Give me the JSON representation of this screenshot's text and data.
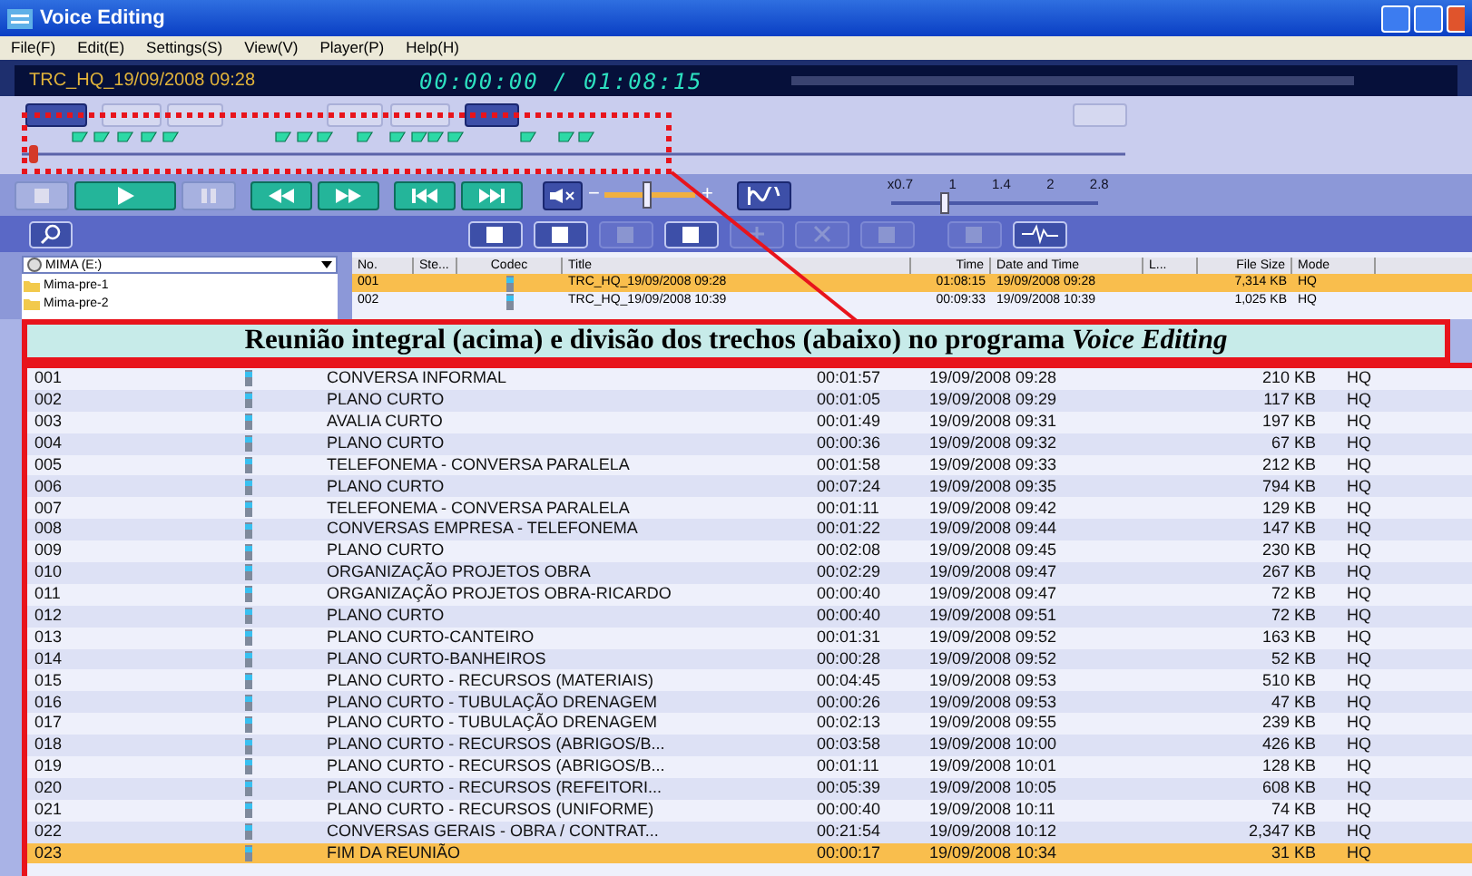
{
  "window": {
    "title": "Voice Editing"
  },
  "menu": [
    "File(F)",
    "Edit(E)",
    "Settings(S)",
    "View(V)",
    "Player(P)",
    "Help(H)"
  ],
  "display": {
    "track": "TRC_HQ_19/09/2008 09:28",
    "time": "00:00:00 / 01:08:15"
  },
  "volume": {
    "minus": "−",
    "plus": "+",
    "level": 0.45
  },
  "speed": {
    "labels": [
      "x0.7",
      "1",
      "1.4",
      "2",
      "2.8"
    ],
    "level": 0.25
  },
  "folders": {
    "drive": "MIMA (E:)",
    "items": [
      "Mima-pre-1",
      "Mima-pre-2"
    ]
  },
  "file_list": {
    "columns": [
      "No.",
      "Ste...",
      "Codec",
      "Title",
      "Time",
      "Date and Time",
      "L...",
      "File Size",
      "Mode"
    ],
    "rows": [
      {
        "no": "001",
        "title": "TRC_HQ_19/09/2008 09:28",
        "time": "01:08:15",
        "date": "19/09/2008 09:28",
        "size": "7,314 KB",
        "mode": "HQ",
        "selected": true
      },
      {
        "no": "002",
        "title": "TRC_HQ_19/09/2008 10:39",
        "time": "00:09:33",
        "date": "19/09/2008 10:39",
        "size": "1,025 KB",
        "mode": "HQ",
        "selected": false
      }
    ]
  },
  "caption": "Reunião integral (acima) e divisão dos trechos (abaixo) no programa *Voice Editing*",
  "segments": [
    {
      "no": "001",
      "title": "CONVERSA INFORMAL",
      "time": "00:01:57",
      "date": "19/09/2008 09:28",
      "size": "210 KB",
      "mode": "HQ",
      "selected": false
    },
    {
      "no": "002",
      "title": "PLANO CURTO",
      "time": "00:01:05",
      "date": "19/09/2008 09:29",
      "size": "117 KB",
      "mode": "HQ",
      "selected": false
    },
    {
      "no": "003",
      "title": "AVALIA CURTO",
      "time": "00:01:49",
      "date": "19/09/2008 09:31",
      "size": "197 KB",
      "mode": "HQ",
      "selected": false
    },
    {
      "no": "004",
      "title": "PLANO CURTO",
      "time": "00:00:36",
      "date": "19/09/2008 09:32",
      "size": "67 KB",
      "mode": "HQ",
      "selected": false
    },
    {
      "no": "005",
      "title": "TELEFONEMA - CONVERSA PARALELA",
      "time": "00:01:58",
      "date": "19/09/2008 09:33",
      "size": "212 KB",
      "mode": "HQ",
      "selected": false
    },
    {
      "no": "006",
      "title": "PLANO CURTO",
      "time": "00:07:24",
      "date": "19/09/2008 09:35",
      "size": "794 KB",
      "mode": "HQ",
      "selected": false
    },
    {
      "no": "007",
      "title": "TELEFONEMA - CONVERSA PARALELA",
      "time": "00:01:11",
      "date": "19/09/2008 09:42",
      "size": "129 KB",
      "mode": "HQ",
      "selected": false
    },
    {
      "no": "008",
      "title": "CONVERSAS EMPRESA - TELEFONEMA",
      "time": "00:01:22",
      "date": "19/09/2008 09:44",
      "size": "147 KB",
      "mode": "HQ",
      "selected": false
    },
    {
      "no": "009",
      "title": "PLANO CURTO",
      "time": "00:02:08",
      "date": "19/09/2008 09:45",
      "size": "230 KB",
      "mode": "HQ",
      "selected": false
    },
    {
      "no": "010",
      "title": "ORGANIZAÇÃO PROJETOS OBRA",
      "time": "00:02:29",
      "date": "19/09/2008 09:47",
      "size": "267 KB",
      "mode": "HQ",
      "selected": false
    },
    {
      "no": "011",
      "title": "ORGANIZAÇÃO PROJETOS OBRA-RICARDO",
      "time": "00:00:40",
      "date": "19/09/2008 09:47",
      "size": "72 KB",
      "mode": "HQ",
      "selected": false
    },
    {
      "no": "012",
      "title": "PLANO CURTO",
      "time": "00:00:40",
      "date": "19/09/2008 09:51",
      "size": "72 KB",
      "mode": "HQ",
      "selected": false
    },
    {
      "no": "013",
      "title": "PLANO CURTO-CANTEIRO",
      "time": "00:01:31",
      "date": "19/09/2008 09:52",
      "size": "163 KB",
      "mode": "HQ",
      "selected": false
    },
    {
      "no": "014",
      "title": "PLANO CURTO-BANHEIROS",
      "time": "00:00:28",
      "date": "19/09/2008 09:52",
      "size": "52 KB",
      "mode": "HQ",
      "selected": false
    },
    {
      "no": "015",
      "title": "PLANO CURTO - RECURSOS (MATERIAIS)",
      "time": "00:04:45",
      "date": "19/09/2008 09:53",
      "size": "510 KB",
      "mode": "HQ",
      "selected": false
    },
    {
      "no": "016",
      "title": "PLANO CURTO - TUBULAÇÃO DRENAGEM",
      "time": "00:00:26",
      "date": "19/09/2008 09:53",
      "size": "47 KB",
      "mode": "HQ",
      "selected": false
    },
    {
      "no": "017",
      "title": "PLANO CURTO - TUBULAÇÃO DRENAGEM",
      "time": "00:02:13",
      "date": "19/09/2008 09:55",
      "size": "239 KB",
      "mode": "HQ",
      "selected": false
    },
    {
      "no": "018",
      "title": "PLANO CURTO - RECURSOS (ABRIGOS/B...",
      "time": "00:03:58",
      "date": "19/09/2008 10:00",
      "size": "426 KB",
      "mode": "HQ",
      "selected": false
    },
    {
      "no": "019",
      "title": "PLANO CURTO - RECURSOS (ABRIGOS/B...",
      "time": "00:01:11",
      "date": "19/09/2008 10:01",
      "size": "128 KB",
      "mode": "HQ",
      "selected": false
    },
    {
      "no": "020",
      "title": "PLANO CURTO - RECURSOS (REFEITORI...",
      "time": "00:05:39",
      "date": "19/09/2008 10:05",
      "size": "608 KB",
      "mode": "HQ",
      "selected": false
    },
    {
      "no": "021",
      "title": "PLANO CURTO - RECURSOS (UNIFORME)",
      "time": "00:00:40",
      "date": "19/09/2008 10:11",
      "size": "74 KB",
      "mode": "HQ",
      "selected": false
    },
    {
      "no": "022",
      "title": "CONVERSAS GERAIS - OBRA / CONTRAT...",
      "time": "00:21:54",
      "date": "19/09/2008 10:12",
      "size": "2,347 KB",
      "mode": "HQ",
      "selected": false
    },
    {
      "no": "023",
      "title": "FIM DA REUNIÃO",
      "time": "00:00:17",
      "date": "19/09/2008 10:34",
      "size": "31 KB",
      "mode": "HQ",
      "selected": true
    }
  ]
}
